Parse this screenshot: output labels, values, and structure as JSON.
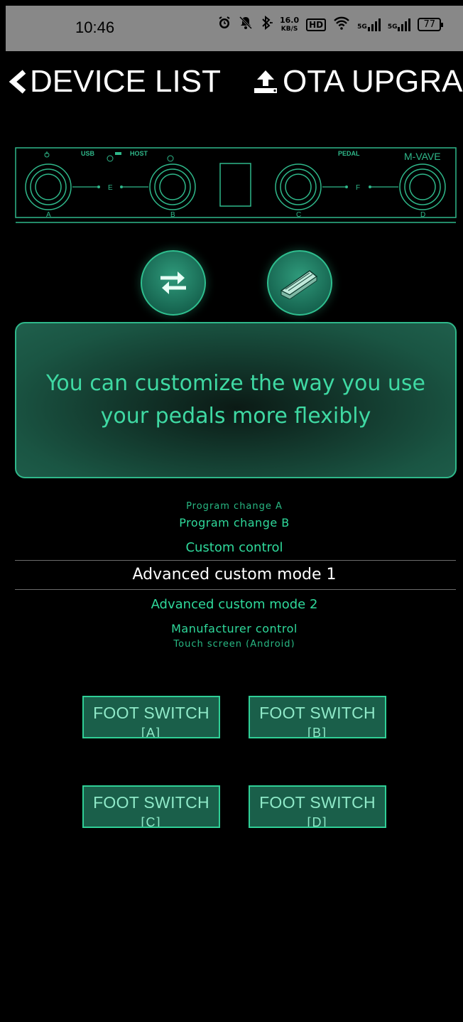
{
  "status_bar": {
    "time": "10:46",
    "network_speed_value": "16.0",
    "network_speed_unit": "KB/S",
    "hd_badge": "HD",
    "signal1": "5G",
    "signal2": "5G",
    "battery": "77"
  },
  "header": {
    "back_label": "DEVICE LIST",
    "ota_label": "OTA UPGRAD"
  },
  "device": {
    "brand": "M-VAVE",
    "usb_label": "USB",
    "host_label": "HOST",
    "pedal_label": "PEDAL",
    "switch_letters": [
      "A",
      "B",
      "C",
      "D"
    ],
    "link_letters": [
      "E",
      "F"
    ],
    "accent_color": "#2fb88a"
  },
  "mode_buttons": {
    "swap_icon": "swap-arrows-icon",
    "pedal_icon": "expression-pedal-icon"
  },
  "info": {
    "text": "You can customize the way you use your pedals more flexibly"
  },
  "picker": {
    "items": [
      "Program change A",
      "Program change B",
      "Custom control",
      "Advanced custom mode 1",
      "Advanced custom mode 2",
      "Manufacturer control",
      "Touch screen (Android)"
    ],
    "selected": "Advanced custom mode 1"
  },
  "foot_switches": [
    {
      "title": "FOOT SWITCH",
      "id": "[A]"
    },
    {
      "title": "FOOT SWITCH",
      "id": "[B]"
    },
    {
      "title": "FOOT SWITCH",
      "id": "[C]"
    },
    {
      "title": "FOOT SWITCH",
      "id": "[D]"
    }
  ]
}
